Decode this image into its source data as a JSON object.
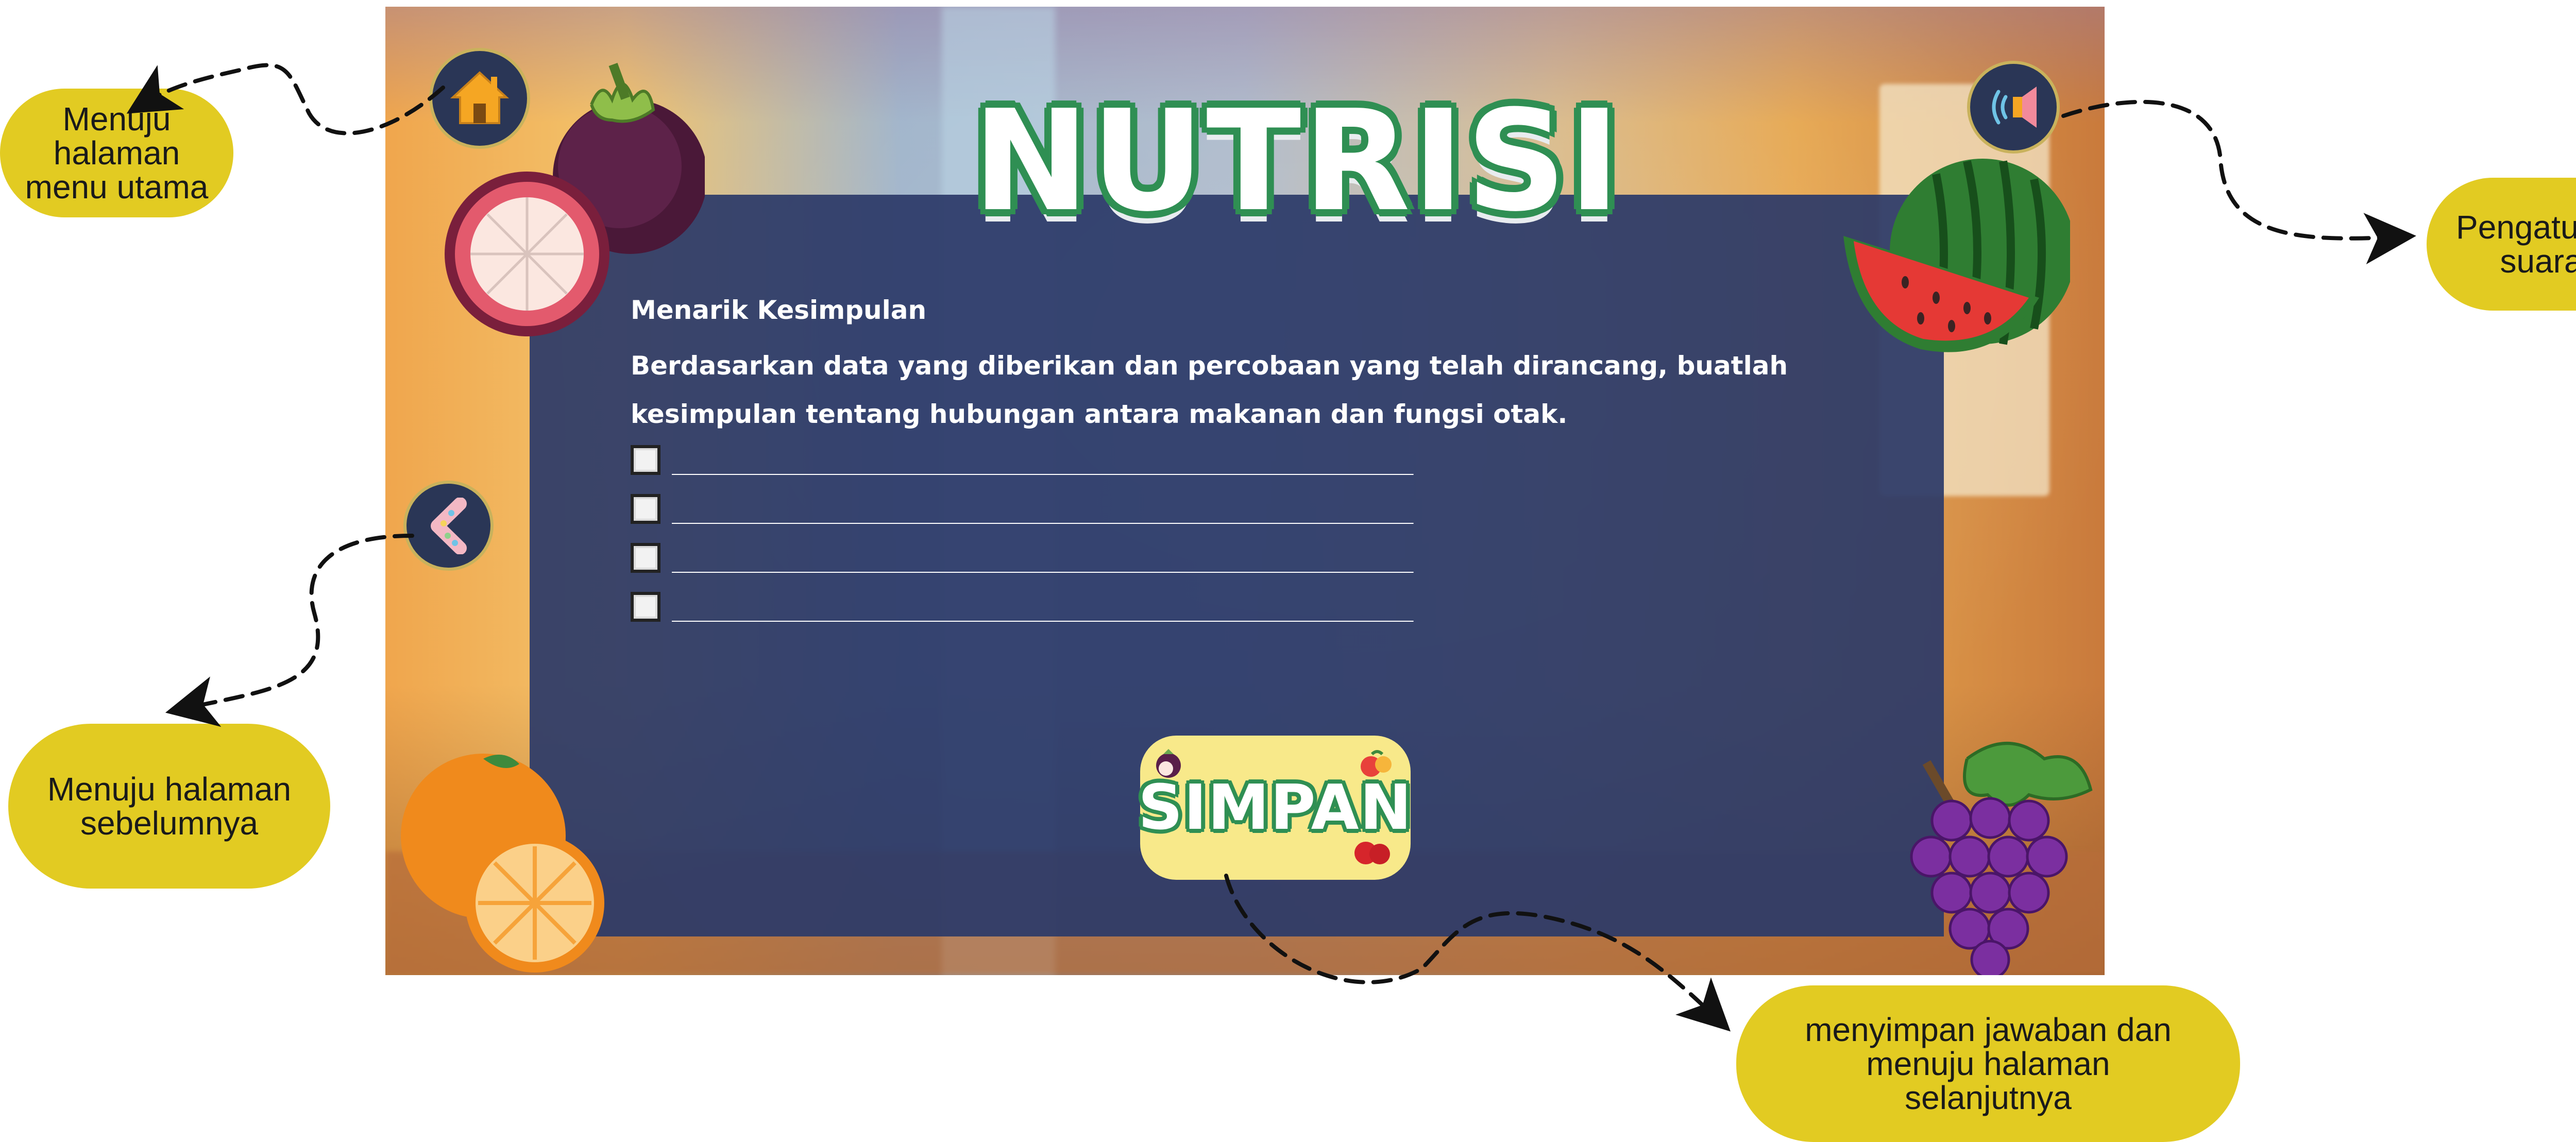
{
  "game": {
    "title": "NUTRISI",
    "heading": "Menarik Kesimpulan",
    "instruction": "Berdasarkan data yang diberikan dan percobaan yang telah dirancang, buatlah kesimpulan tentang hubungan antara makanan dan fungsi otak.",
    "options": [
      {
        "blank": "_______________________________________________________",
        "checked": false
      },
      {
        "blank": "_______________________________________________________",
        "checked": false
      },
      {
        "blank": "_______________________________________________________",
        "checked": false
      },
      {
        "blank": "_______________________________________________________",
        "checked": false
      }
    ],
    "save_label": "SIMPAN",
    "icons": {
      "home": "home-icon",
      "back": "chevron-left-icon",
      "sound": "speaker-icon"
    },
    "colors": {
      "panel": "#2c3a68",
      "title_outline": "#2f8f53",
      "button_yellow": "#f8e98a",
      "callout_yellow": "#e2cb22"
    }
  },
  "annotations": {
    "home": [
      "Menuju",
      "halaman",
      "menu utama"
    ],
    "back": [
      "Menuju halaman",
      "sebelumnya"
    ],
    "sound": [
      "Pengaturan",
      "suara"
    ],
    "save": [
      "menyimpan jawaban dan",
      "menuju halaman",
      "selanjutnya"
    ]
  }
}
